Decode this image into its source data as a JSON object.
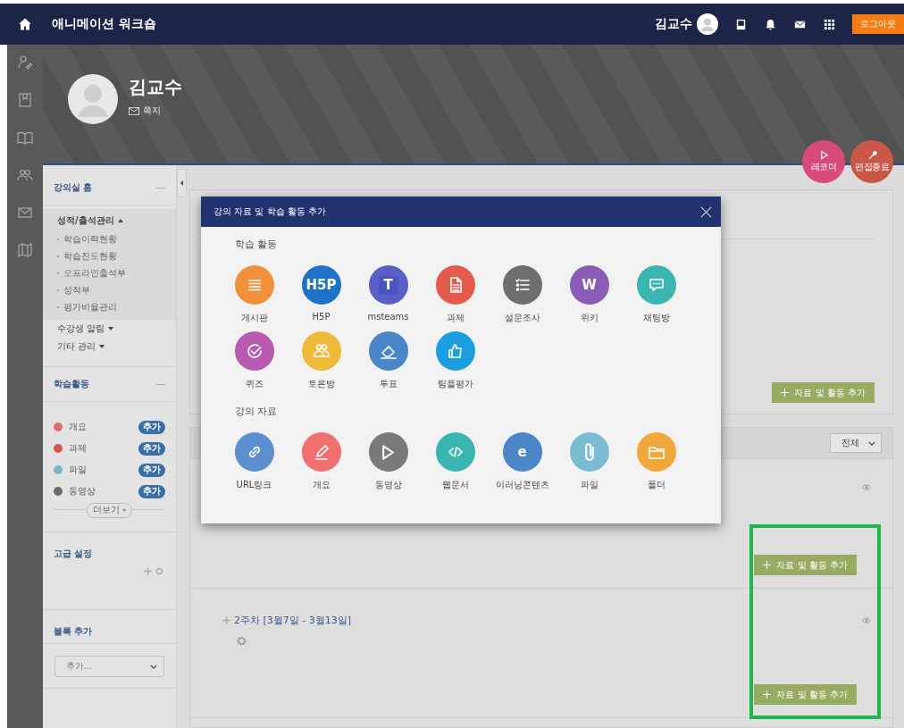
{
  "top_bar": {
    "site_title": "애니메이션 워크숍",
    "user_name": "김교수",
    "logout": "로그아웃"
  },
  "profile": {
    "name": "김교수",
    "message_link": "쪽지"
  },
  "float_buttons": [
    {
      "label": "레코더",
      "kind": "recorder"
    },
    {
      "label": "편집종료",
      "kind": "edit"
    }
  ],
  "course_block": {
    "title": "강의실 홈",
    "menus": [
      {
        "label": "성적/출석관리",
        "expanded": true,
        "children": [
          {
            "label": "학습이력현황"
          },
          {
            "label": "학습진도현황"
          },
          {
            "label": "오프라인출석부"
          },
          {
            "label": "성적부"
          },
          {
            "label": "평가비율관리"
          }
        ]
      },
      {
        "label": "수강생 알림",
        "expanded": false
      },
      {
        "label": "기타 관리",
        "expanded": false
      }
    ]
  },
  "activity_block": {
    "title": "학습활동",
    "items": [
      {
        "label": "개요",
        "color": "#e06b6b",
        "action": "추가"
      },
      {
        "label": "과제",
        "color": "#d9534f",
        "action": "추가"
      },
      {
        "label": "파일",
        "color": "#7fb6cc",
        "action": "추가"
      },
      {
        "label": "동영상",
        "color": "#6b6b6b",
        "action": "추가"
      }
    ],
    "more": "더보기"
  },
  "advanced_block": {
    "title": "고급 설정"
  },
  "add_block": {
    "title": "블록 추가",
    "select": "추가..."
  },
  "top_section": {
    "add_button": "자료 및 활동 추가"
  },
  "filter": "전체",
  "sections": [
    {
      "add_button": "자료 및 활동 추가"
    },
    {
      "title": "2주차 [3월7일 - 3월13일]",
      "add_button": "자료 및 활동 추가"
    }
  ],
  "modal": {
    "title": "강의 자료 및 학습 활동 추가",
    "groups": [
      {
        "title": "학습 활동",
        "items": [
          {
            "label": "게시판",
            "kind": "board",
            "color": "#f0903a"
          },
          {
            "label": "H5P",
            "kind": "text",
            "icon_text": "H5P",
            "color": "#1e73c8"
          },
          {
            "label": "msteams",
            "kind": "teams",
            "icon_text": "T",
            "color": "#5a5fc8"
          },
          {
            "label": "과제",
            "kind": "assignment",
            "color": "#e45a4c"
          },
          {
            "label": "설문조사",
            "kind": "survey",
            "color": "#6e6e6e"
          },
          {
            "label": "위키",
            "kind": "text",
            "icon_text": "W",
            "color": "#8a5cb8"
          },
          {
            "label": "채팅방",
            "kind": "chat",
            "color": "#3bb5b0"
          },
          {
            "label": "퀴즈",
            "kind": "quiz",
            "color": "#b85ab0"
          },
          {
            "label": "토론방",
            "kind": "forum",
            "color": "#f0b93a"
          },
          {
            "label": "투표",
            "kind": "vote",
            "color": "#4a86c8"
          },
          {
            "label": "팀플평가",
            "kind": "peer",
            "color": "#1a9ee0"
          }
        ]
      },
      {
        "title": "강의 자료",
        "items": [
          {
            "label": "URL링크",
            "kind": "url",
            "color": "#5b8fcf"
          },
          {
            "label": "개요",
            "kind": "summary",
            "color": "#f07070"
          },
          {
            "label": "동영상",
            "kind": "video",
            "color": "#7a7a7a"
          },
          {
            "label": "웹문서",
            "kind": "webdoc",
            "color": "#3ab5b0"
          },
          {
            "label": "이러닝콘텐츠",
            "kind": "text",
            "icon_text": "e",
            "color": "#4a86c8"
          },
          {
            "label": "파일",
            "kind": "file",
            "color": "#7bbcd4"
          },
          {
            "label": "폴더",
            "kind": "folder",
            "color": "#f0a83a"
          }
        ]
      }
    ]
  }
}
